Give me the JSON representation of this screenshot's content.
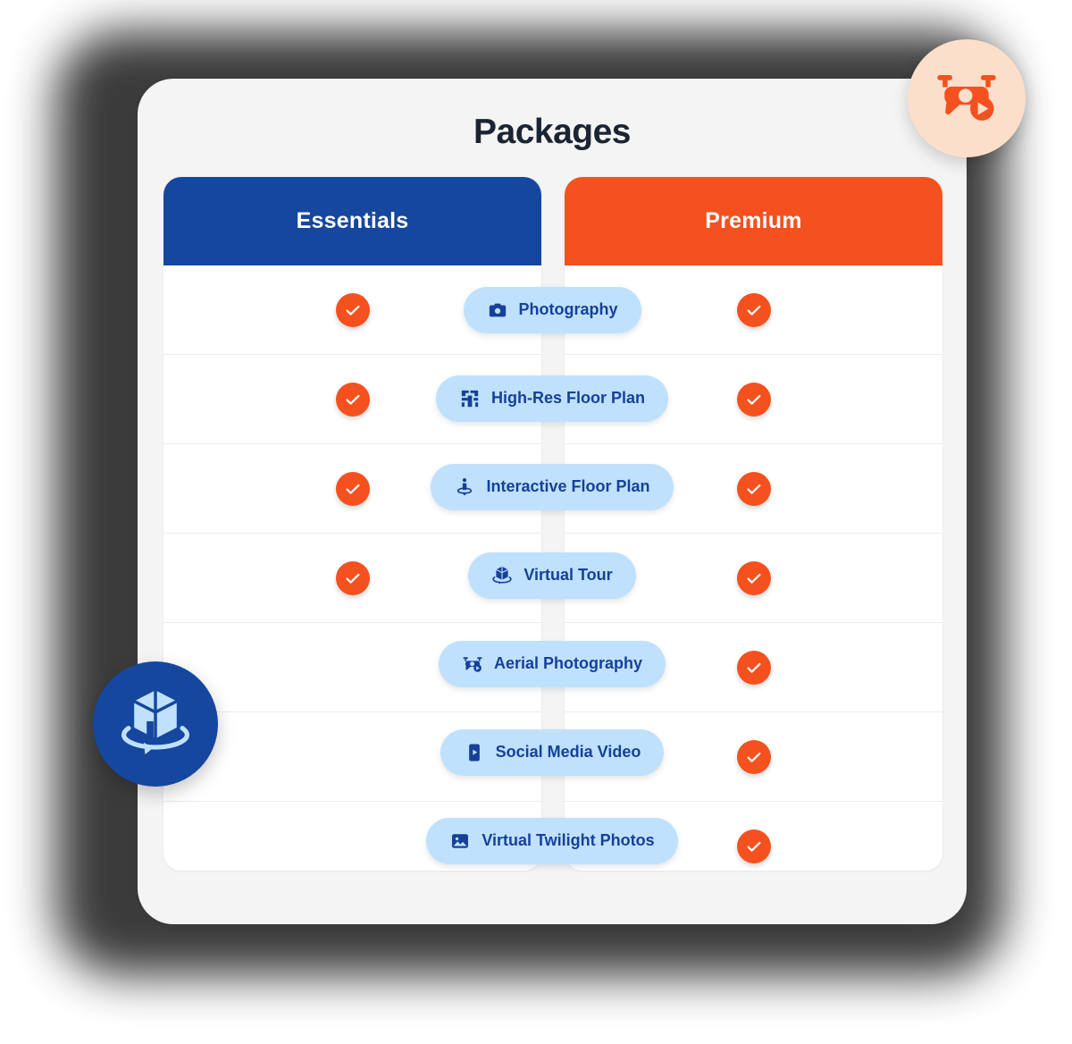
{
  "page": {
    "title": "Packages"
  },
  "columns": [
    {
      "id": "essentials",
      "label": "Essentials",
      "color": "#15479E"
    },
    {
      "id": "premium",
      "label": "Premium",
      "color": "#F4511E"
    }
  ],
  "features": [
    {
      "label": "Photography",
      "icon": "camera-icon",
      "essentials": true,
      "premium": true
    },
    {
      "label": "High-Res Floor Plan",
      "icon": "floor-plan-icon",
      "essentials": true,
      "premium": true
    },
    {
      "label": "Interactive Floor Plan",
      "icon": "location-person-icon",
      "essentials": true,
      "premium": true
    },
    {
      "label": "Virtual Tour",
      "icon": "cube-rotate-icon",
      "essentials": true,
      "premium": true
    },
    {
      "label": "Aerial Photography",
      "icon": "drone-icon",
      "essentials": false,
      "premium": true
    },
    {
      "label": "Social Media Video",
      "icon": "phone-play-icon",
      "essentials": false,
      "premium": true
    },
    {
      "label": "Virtual Twilight Photos",
      "icon": "image-icon",
      "essentials": false,
      "premium": true
    }
  ],
  "badges": [
    {
      "id": "aerial",
      "icon": "drone-video-icon",
      "background": "#FCDFCB",
      "icon_color": "#F4511E"
    },
    {
      "id": "virtual-tour",
      "icon": "cube-rotate-icon",
      "background": "#15479E",
      "icon_color": "#BFE1FD"
    }
  ],
  "theme": {
    "check_color": "#F4511E",
    "pill_background": "#BFE1FD",
    "pill_text": "#16409A",
    "card_background": "#F4F4F4",
    "title_color": "#1B2433"
  }
}
